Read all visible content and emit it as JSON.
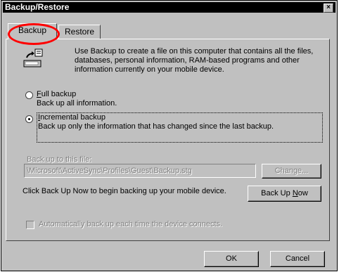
{
  "window": {
    "title": "Backup/Restore",
    "close_glyph": "×"
  },
  "tabs": [
    {
      "label": "Backup",
      "selected": true
    },
    {
      "label": "Restore",
      "selected": false
    }
  ],
  "intro": {
    "icon": "backup-device-icon",
    "text": "Use Backup to create a file on this computer that contains all the files, databases, personal information, RAM-based programs and other information currently on your mobile device."
  },
  "options": {
    "full": {
      "label": "Full backup",
      "accel": "F",
      "desc": "Back up all information.",
      "selected": false
    },
    "incremental": {
      "label": "Incremental backup",
      "accel": "I",
      "desc": "Back up only the information that has changed since the last backup.",
      "selected": true
    }
  },
  "file": {
    "label": "Back up to this file:",
    "path": "\\Microsoft\\ActiveSync\\Profiles\\Guest\\Backup.stg",
    "change_label": "Change..."
  },
  "backup_now": {
    "note": "Click Back Up Now to begin backing up your mobile device.",
    "label_prefix": "Back Up ",
    "label_accel": "N",
    "label_suffix": "ow"
  },
  "auto_backup": {
    "label": "Automatically back up each time the device connects.",
    "checked": false
  },
  "footer": {
    "ok_label": "OK",
    "cancel_label": "Cancel"
  },
  "colors": {
    "titlebar": "#000000",
    "face": "#c0c0c0",
    "annotation_circle": "#ff0000"
  }
}
